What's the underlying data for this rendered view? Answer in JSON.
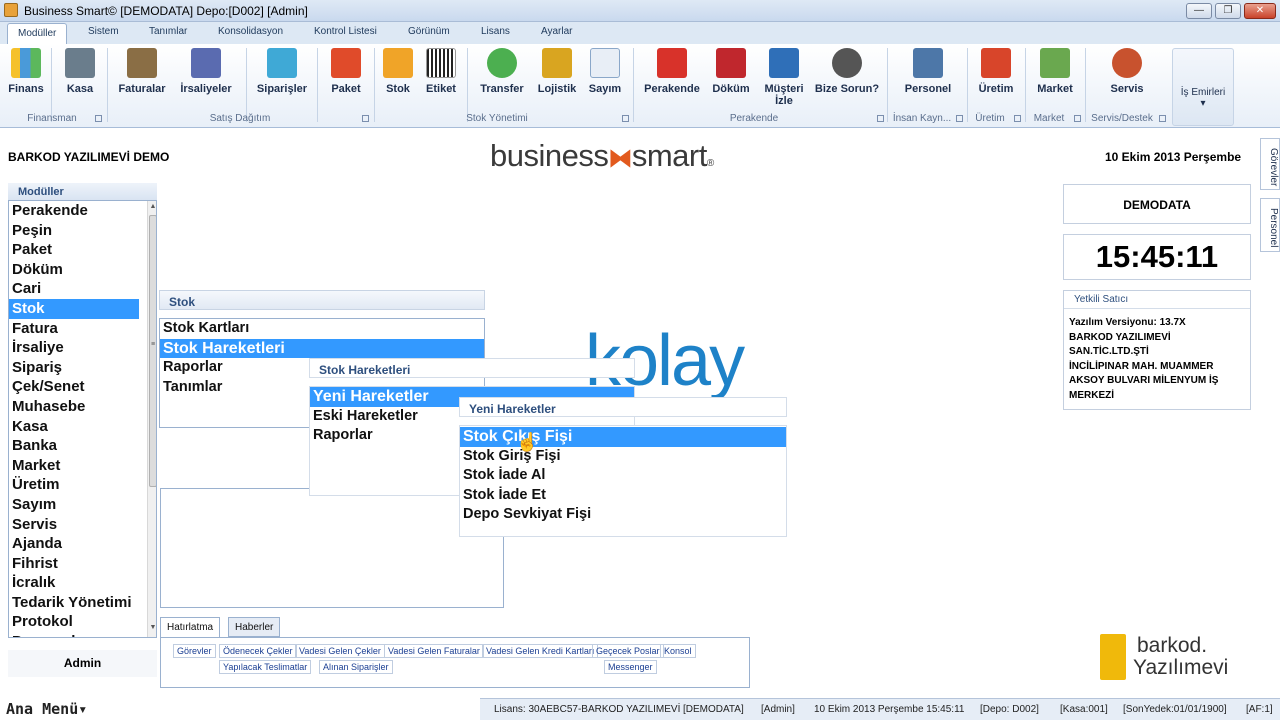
{
  "window": {
    "title": "Business Smart© [DEMODATA] Depo:[D002] [Admin]",
    "min_glyph": "—",
    "max_glyph": "❐",
    "close_glyph": "✕"
  },
  "ribbon_tabs": [
    "Modüller",
    "Sistem",
    "Tanımlar",
    "Konsolidasyon",
    "Kontrol Listesi",
    "Görünüm",
    "Lisans",
    "Ayarlar"
  ],
  "ribbon_buttons": [
    {
      "label": "Finans",
      "icon": "bar-chart-icon",
      "color": "#3a8fd6"
    },
    {
      "label": "Kasa",
      "icon": "safe-icon",
      "color": "#6a7d8c"
    },
    {
      "label": "Faturalar",
      "icon": "invoice-icon",
      "color": "#8a6e45"
    },
    {
      "label": "İrsaliyeler",
      "icon": "delivery-note-icon",
      "color": "#5a6bb0"
    },
    {
      "label": "Siparişler",
      "icon": "basket-icon",
      "color": "#3fa9d6"
    },
    {
      "label": "Paket",
      "icon": "package-icon",
      "color": "#e04b2a"
    },
    {
      "label": "Stok",
      "icon": "stock-boxes-icon",
      "color": "#f0a428"
    },
    {
      "label": "Etiket",
      "icon": "barcode-icon",
      "color": "#333333"
    },
    {
      "label": "Transfer",
      "icon": "transfer-icon",
      "color": "#4caf50"
    },
    {
      "label": "Lojistik",
      "icon": "forklift-icon",
      "color": "#d9a520"
    },
    {
      "label": "Sayım",
      "icon": "checklist-icon",
      "color": "#8aa7c9"
    },
    {
      "label": "Perakende",
      "icon": "shopping-basket-icon",
      "color": "#d8322a"
    },
    {
      "label": "Döküm",
      "icon": "book-icon",
      "color": "#c0272d"
    },
    {
      "label": "Müşteri İzle",
      "icon": "customers-icon",
      "color": "#2f6fb8"
    },
    {
      "label": "Bize Sorun?",
      "icon": "support-icon",
      "color": "#555555"
    },
    {
      "label": "Personel",
      "icon": "staff-icon",
      "color": "#4d77a8"
    },
    {
      "label": "Üretim",
      "icon": "factory-icon",
      "color": "#d8452a"
    },
    {
      "label": "Market",
      "icon": "cart-icon",
      "color": "#6aa84f"
    },
    {
      "label": "Servis",
      "icon": "technician-icon",
      "color": "#c8522e"
    }
  ],
  "ribbon_groups": [
    "Finansman",
    "Satış Dağıtım",
    "Stok Yönetimi",
    "Perakende",
    "İnsan Kayn...",
    "Üretim",
    "Market",
    "Servis/Destek"
  ],
  "is_emirleri": {
    "label": "İş Emirleri",
    "arrow": "▾"
  },
  "side_tabs": [
    "Görevler",
    "Personel"
  ],
  "header": {
    "company": "BARKOD YAZILIMEVİ DEMO",
    "brand_left": "business",
    "brand_bow": "⧓",
    "brand_right": "smart",
    "brand_reg": "®",
    "date": "10 Ekim 2013 Perşembe"
  },
  "modules": {
    "title": "Modüller",
    "items": [
      "Perakende",
      "Peşin",
      "Paket",
      "Döküm",
      "Cari",
      "Stok",
      "Fatura",
      "İrsaliye",
      "Sipariş",
      "Çek/Senet",
      "Muhasebe",
      "Kasa",
      "Banka",
      "Market",
      "Üretim",
      "Sayım",
      "Servis",
      "Ajanda",
      "Fihrist",
      "İcralık",
      "Tedarik Yönetimi",
      "Protokol",
      "Personel"
    ],
    "selected": "Stok",
    "scroll_up": "▲",
    "scroll_mid": "≡",
    "scroll_down": "▼"
  },
  "admin_label": "Admin",
  "stok_panel": {
    "title": "Stok",
    "items": [
      "Stok Kartları",
      "Stok Hareketleri",
      "Raporlar",
      "Tanımlar"
    ],
    "selected": "Stok Hareketleri"
  },
  "stok_hareketleri_panel": {
    "title": "Stok Hareketleri",
    "items": [
      "Yeni Hareketler",
      "Eski Hareketler",
      "Raporlar"
    ],
    "selected": "Yeni Hareketler"
  },
  "yeni_hareketler_panel": {
    "title": "Yeni Hareketler",
    "items": [
      "Stok Çıkış Fişi",
      "Stok Giriş Fişi",
      "Stok İade Al",
      "Stok İade Et",
      "Depo Sevkiyat Fişi"
    ],
    "selected": "Stok Çıkış Fişi"
  },
  "kolay_logo": "kolay",
  "cursor_glyph": "☝",
  "bottom_tabs": [
    "Hatırlatma",
    "Haberler"
  ],
  "reminder_links_row1": [
    "Görevler",
    "Ödenecek Çekler",
    "Vadesi Gelen Çekler",
    "Vadesi Gelen Faturalar",
    "Vadesi Gelen Kredi Kartları",
    "Geçecek Poslar",
    "Konsol"
  ],
  "reminder_links_row2": [
    "Yapılacak Teslimatlar",
    "Alınan Siparişler",
    "Messenger"
  ],
  "right_panel": {
    "database": "DEMODATA",
    "clock": "15:45:11",
    "dealer_title": "Yetkili Satıcı",
    "dealer_lines": [
      "Yazılım Versiyonu: 13.7X",
      "BARKOD YAZILIMEVİ",
      "SAN.TİC.LTD.ŞTİ",
      "İNCİLİPINAR MAH. MUAMMER",
      "AKSOY BULVARI MİLENYUM İŞ",
      "MERKEZİ"
    ]
  },
  "barkod_logo": {
    "line1": "barkod.",
    "line2": "Yazılımevi"
  },
  "ana_menu": "Ana Menü▾",
  "status": [
    "Lisans: 30AEBC57-BARKOD YAZILIMEVİ",
    "[DEMODATA]",
    "[Admin]",
    "10 Ekim 2013 Perşembe 15:45:11",
    "[Depo: D002]",
    "[Kasa:001]",
    "[SonYedek:01/01/1900]",
    "[AF:1]"
  ]
}
